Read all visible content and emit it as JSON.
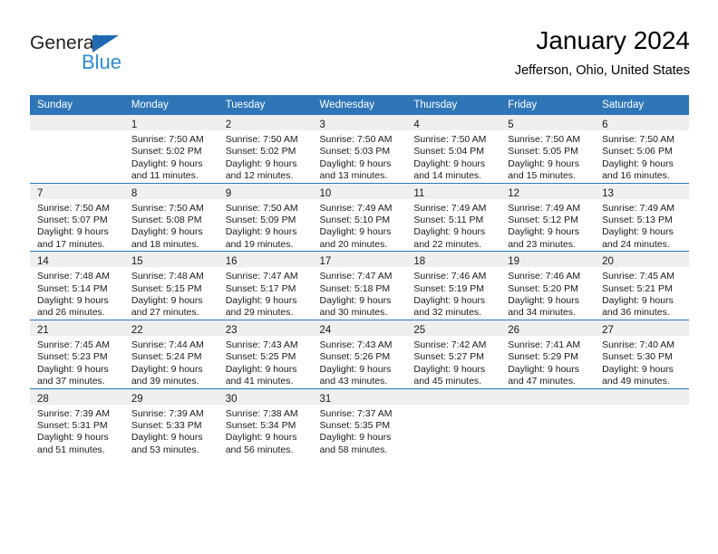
{
  "logo": {
    "word_dark": "General",
    "word_blue": "Blue",
    "triangle_icon": "triangle-icon",
    "colors": {
      "dark": "#231f20",
      "blue": "#2e8bd0",
      "triangle": "#1f6ab0"
    }
  },
  "header": {
    "title": "January 2024",
    "subtitle": "Jefferson, Ohio, United States"
  },
  "theme": {
    "header_blue": "#2f76b8",
    "band_gray": "#efefef",
    "text": "#1a1a1a"
  },
  "calendar": {
    "weekday_headers": [
      "Sunday",
      "Monday",
      "Tuesday",
      "Wednesday",
      "Thursday",
      "Friday",
      "Saturday"
    ],
    "weeks": [
      [
        {
          "day": "",
          "lines": []
        },
        {
          "day": "1",
          "lines": [
            "Sunrise: 7:50 AM",
            "Sunset: 5:02 PM",
            "Daylight: 9 hours",
            "and 11 minutes."
          ]
        },
        {
          "day": "2",
          "lines": [
            "Sunrise: 7:50 AM",
            "Sunset: 5:02 PM",
            "Daylight: 9 hours",
            "and 12 minutes."
          ]
        },
        {
          "day": "3",
          "lines": [
            "Sunrise: 7:50 AM",
            "Sunset: 5:03 PM",
            "Daylight: 9 hours",
            "and 13 minutes."
          ]
        },
        {
          "day": "4",
          "lines": [
            "Sunrise: 7:50 AM",
            "Sunset: 5:04 PM",
            "Daylight: 9 hours",
            "and 14 minutes."
          ]
        },
        {
          "day": "5",
          "lines": [
            "Sunrise: 7:50 AM",
            "Sunset: 5:05 PM",
            "Daylight: 9 hours",
            "and 15 minutes."
          ]
        },
        {
          "day": "6",
          "lines": [
            "Sunrise: 7:50 AM",
            "Sunset: 5:06 PM",
            "Daylight: 9 hours",
            "and 16 minutes."
          ]
        }
      ],
      [
        {
          "day": "7",
          "lines": [
            "Sunrise: 7:50 AM",
            "Sunset: 5:07 PM",
            "Daylight: 9 hours",
            "and 17 minutes."
          ]
        },
        {
          "day": "8",
          "lines": [
            "Sunrise: 7:50 AM",
            "Sunset: 5:08 PM",
            "Daylight: 9 hours",
            "and 18 minutes."
          ]
        },
        {
          "day": "9",
          "lines": [
            "Sunrise: 7:50 AM",
            "Sunset: 5:09 PM",
            "Daylight: 9 hours",
            "and 19 minutes."
          ]
        },
        {
          "day": "10",
          "lines": [
            "Sunrise: 7:49 AM",
            "Sunset: 5:10 PM",
            "Daylight: 9 hours",
            "and 20 minutes."
          ]
        },
        {
          "day": "11",
          "lines": [
            "Sunrise: 7:49 AM",
            "Sunset: 5:11 PM",
            "Daylight: 9 hours",
            "and 22 minutes."
          ]
        },
        {
          "day": "12",
          "lines": [
            "Sunrise: 7:49 AM",
            "Sunset: 5:12 PM",
            "Daylight: 9 hours",
            "and 23 minutes."
          ]
        },
        {
          "day": "13",
          "lines": [
            "Sunrise: 7:49 AM",
            "Sunset: 5:13 PM",
            "Daylight: 9 hours",
            "and 24 minutes."
          ]
        }
      ],
      [
        {
          "day": "14",
          "lines": [
            "Sunrise: 7:48 AM",
            "Sunset: 5:14 PM",
            "Daylight: 9 hours",
            "and 26 minutes."
          ]
        },
        {
          "day": "15",
          "lines": [
            "Sunrise: 7:48 AM",
            "Sunset: 5:15 PM",
            "Daylight: 9 hours",
            "and 27 minutes."
          ]
        },
        {
          "day": "16",
          "lines": [
            "Sunrise: 7:47 AM",
            "Sunset: 5:17 PM",
            "Daylight: 9 hours",
            "and 29 minutes."
          ]
        },
        {
          "day": "17",
          "lines": [
            "Sunrise: 7:47 AM",
            "Sunset: 5:18 PM",
            "Daylight: 9 hours",
            "and 30 minutes."
          ]
        },
        {
          "day": "18",
          "lines": [
            "Sunrise: 7:46 AM",
            "Sunset: 5:19 PM",
            "Daylight: 9 hours",
            "and 32 minutes."
          ]
        },
        {
          "day": "19",
          "lines": [
            "Sunrise: 7:46 AM",
            "Sunset: 5:20 PM",
            "Daylight: 9 hours",
            "and 34 minutes."
          ]
        },
        {
          "day": "20",
          "lines": [
            "Sunrise: 7:45 AM",
            "Sunset: 5:21 PM",
            "Daylight: 9 hours",
            "and 36 minutes."
          ]
        }
      ],
      [
        {
          "day": "21",
          "lines": [
            "Sunrise: 7:45 AM",
            "Sunset: 5:23 PM",
            "Daylight: 9 hours",
            "and 37 minutes."
          ]
        },
        {
          "day": "22",
          "lines": [
            "Sunrise: 7:44 AM",
            "Sunset: 5:24 PM",
            "Daylight: 9 hours",
            "and 39 minutes."
          ]
        },
        {
          "day": "23",
          "lines": [
            "Sunrise: 7:43 AM",
            "Sunset: 5:25 PM",
            "Daylight: 9 hours",
            "and 41 minutes."
          ]
        },
        {
          "day": "24",
          "lines": [
            "Sunrise: 7:43 AM",
            "Sunset: 5:26 PM",
            "Daylight: 9 hours",
            "and 43 minutes."
          ]
        },
        {
          "day": "25",
          "lines": [
            "Sunrise: 7:42 AM",
            "Sunset: 5:27 PM",
            "Daylight: 9 hours",
            "and 45 minutes."
          ]
        },
        {
          "day": "26",
          "lines": [
            "Sunrise: 7:41 AM",
            "Sunset: 5:29 PM",
            "Daylight: 9 hours",
            "and 47 minutes."
          ]
        },
        {
          "day": "27",
          "lines": [
            "Sunrise: 7:40 AM",
            "Sunset: 5:30 PM",
            "Daylight: 9 hours",
            "and 49 minutes."
          ]
        }
      ],
      [
        {
          "day": "28",
          "lines": [
            "Sunrise: 7:39 AM",
            "Sunset: 5:31 PM",
            "Daylight: 9 hours",
            "and 51 minutes."
          ]
        },
        {
          "day": "29",
          "lines": [
            "Sunrise: 7:39 AM",
            "Sunset: 5:33 PM",
            "Daylight: 9 hours",
            "and 53 minutes."
          ]
        },
        {
          "day": "30",
          "lines": [
            "Sunrise: 7:38 AM",
            "Sunset: 5:34 PM",
            "Daylight: 9 hours",
            "and 56 minutes."
          ]
        },
        {
          "day": "31",
          "lines": [
            "Sunrise: 7:37 AM",
            "Sunset: 5:35 PM",
            "Daylight: 9 hours",
            "and 58 minutes."
          ]
        },
        {
          "day": "",
          "lines": []
        },
        {
          "day": "",
          "lines": []
        },
        {
          "day": "",
          "lines": []
        }
      ]
    ]
  }
}
